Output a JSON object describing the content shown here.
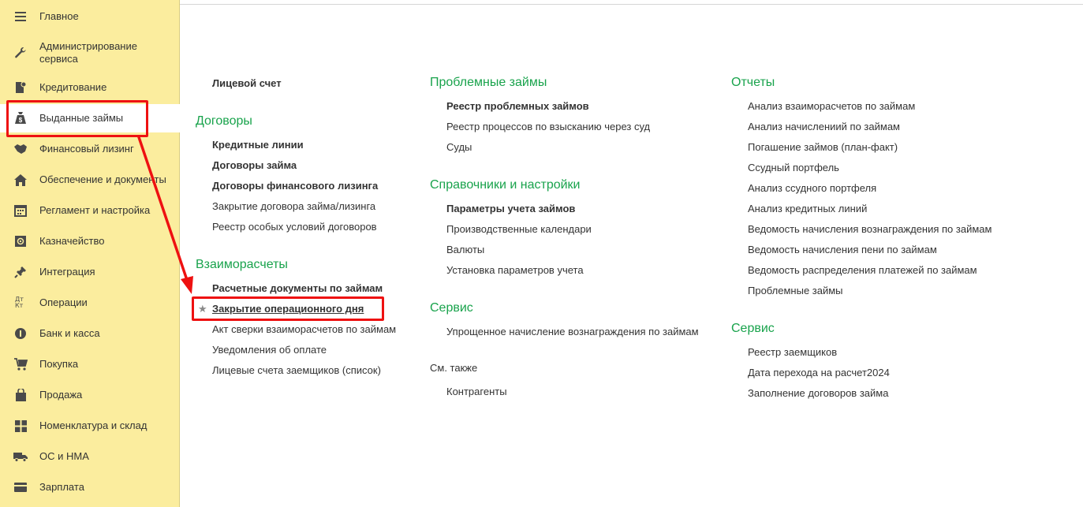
{
  "sidebar": {
    "items": [
      {
        "label": "Главное",
        "icon": "menu-icon"
      },
      {
        "label": "Администрирование сервиса",
        "icon": "wrench-icon"
      },
      {
        "label": "Кредитование",
        "icon": "document-coin-icon"
      },
      {
        "label": "Выданные займы",
        "icon": "money-bag-icon",
        "active": true
      },
      {
        "label": "Финансовый лизинг",
        "icon": "handshake-icon"
      },
      {
        "label": "Обеспечение и документы",
        "icon": "house-icon"
      },
      {
        "label": "Регламент и настройка",
        "icon": "calendar-icon"
      },
      {
        "label": "Казначейство",
        "icon": "safe-icon"
      },
      {
        "label": "Интеграция",
        "icon": "plug-icon"
      },
      {
        "label": "Операции",
        "icon": "debit-credit-icon",
        "icon_text": "Дт Кт"
      },
      {
        "label": "Банк и касса",
        "icon": "coin-icon"
      },
      {
        "label": "Покупка",
        "icon": "cart-icon"
      },
      {
        "label": "Продажа",
        "icon": "shopping-bag-icon"
      },
      {
        "label": "Номенклатура и склад",
        "icon": "grid-icon"
      },
      {
        "label": "ОС и НМА",
        "icon": "truck-icon"
      },
      {
        "label": "Зарплата",
        "icon": "wallet-icon"
      }
    ]
  },
  "col1": {
    "top_link": "Лицевой счет",
    "contracts": {
      "title": "Договоры",
      "links": [
        "Кредитные линии",
        "Договоры займа",
        "Договоры финансового лизинга",
        "Закрытие договора займа/лизинга",
        "Реестр особых условий договоров"
      ]
    },
    "settlements": {
      "title": "Взаиморасчеты",
      "links": [
        "Расчетные документы по займам",
        "Закрытие операционного дня",
        "Акт сверки взаиморасчетов по займам",
        "Уведомления об оплате",
        "Лицевые счета заемщиков (список)"
      ]
    }
  },
  "col2": {
    "problem": {
      "title": "Проблемные займы",
      "links": [
        "Реестр проблемных займов",
        "Реестр процессов по взысканию через суд",
        "Суды"
      ]
    },
    "refs": {
      "title": "Справочники и настройки",
      "links": [
        "Параметры учета займов",
        "Производственные календари",
        "Валюты",
        "Установка параметров учета"
      ]
    },
    "service": {
      "title": "Сервис",
      "links": [
        "Упрощенное начисление вознаграждения по займам"
      ]
    },
    "see_also": {
      "title": "См. также",
      "links": [
        "Контрагенты"
      ]
    }
  },
  "col3": {
    "reports": {
      "title": "Отчеты",
      "links": [
        "Анализ взаиморасчетов по займам",
        "Анализ начислениий по займам",
        "Погашение займов (план-факт)",
        "Ссудный портфель",
        "Анализ ссудного портфеля",
        "Анализ кредитных линий",
        "Ведомость начисления вознаграждения по займам",
        "Ведомость начисления пени по займам",
        "Ведомость распределения платежей по займам",
        "Проблемные займы"
      ]
    },
    "service": {
      "title": "Сервис",
      "links": [
        "Реестр заемщиков",
        "Дата перехода на расчет2024",
        "Заполнение договоров займа"
      ]
    }
  },
  "colors": {
    "accent_green": "#19a34c",
    "sidebar_bg": "#fbed9e",
    "annotation_red": "#ee1111"
  },
  "favorite_icon": "star-icon"
}
